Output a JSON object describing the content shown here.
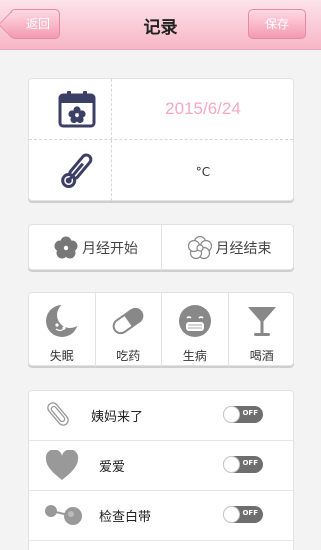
{
  "header": {
    "title": "记录",
    "back_label": "返回",
    "save_label": "保存"
  },
  "record": {
    "date": "2015/6/24",
    "temperature_unit": "°C"
  },
  "menses": {
    "start_label": "月经开始",
    "end_label": "月经结束"
  },
  "status_items": [
    {
      "label": "失眠",
      "icon": "moon-icon"
    },
    {
      "label": "吃药",
      "icon": "pill-icon"
    },
    {
      "label": "生病",
      "icon": "sick-face-icon"
    },
    {
      "label": "喝酒",
      "icon": "cocktail-icon"
    }
  ],
  "toggles": [
    {
      "label": "姨妈来了",
      "icon": "pad-icon",
      "state": "OFF"
    },
    {
      "label": "爱爱",
      "icon": "heart-icon",
      "state": "OFF"
    },
    {
      "label": "检查白带",
      "icon": "check-icon",
      "state": "OFF"
    }
  ]
}
